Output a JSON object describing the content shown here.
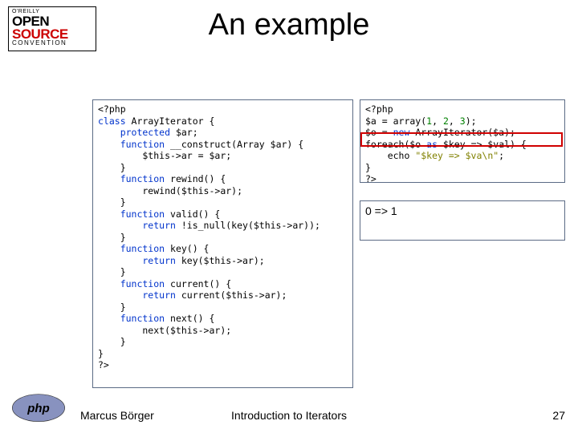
{
  "logo": {
    "line1": "O'REILLY",
    "line2": "OPEN",
    "line3": "SOURCE",
    "line4": "CONVENTION"
  },
  "title": "An example",
  "code_left": {
    "l01a": "<?php",
    "l02a": "class",
    "l02b": " ArrayIterator {",
    "l03a": "    protected",
    "l03b": " $ar;",
    "l04a": "    function",
    "l04b": " __construct(Array $ar) {",
    "l05": "        $this->ar = $ar;",
    "l06": "    }",
    "l07a": "    function",
    "l07b": " rewind() {",
    "l08": "        rewind($this->ar);",
    "l09": "    }",
    "l10a": "    function",
    "l10b": " valid() {",
    "l11a": "        return",
    "l11b": " !is_null(key($this->ar));",
    "l12": "    }",
    "l13a": "    function",
    "l13b": " key() {",
    "l14a": "        return",
    "l14b": " key($this->ar);",
    "l15": "    }",
    "l16a": "    function",
    "l16b": " current() {",
    "l17a": "        return",
    "l17b": " current($this->ar);",
    "l18": "    }",
    "l19a": "    function",
    "l19b": " next() {",
    "l20": "        next($this->ar);",
    "l21": "    }",
    "l22": "}",
    "l23": "?>"
  },
  "code_right": {
    "l1": "<?php",
    "l2a": "$a = array(",
    "l2n1": "1",
    "l2c1": ", ",
    "l2n2": "2",
    "l2c2": ", ",
    "l2n3": "3",
    "l2b": ");",
    "l3a": "$o = ",
    "l3kw": "new",
    "l3b": " ArrayIterator($a);",
    "l4a": "foreach($o ",
    "l4as": "as",
    "l4b": " $key => $val) {",
    "l5a": "    echo ",
    "l5s": "\"$key => $va\\n\"",
    "l5b": ";",
    "l6": "}",
    "l7": "?>"
  },
  "output": "0 => 1",
  "footer": {
    "author": "Marcus Börger",
    "title": "Introduction to Iterators",
    "page": "27"
  }
}
